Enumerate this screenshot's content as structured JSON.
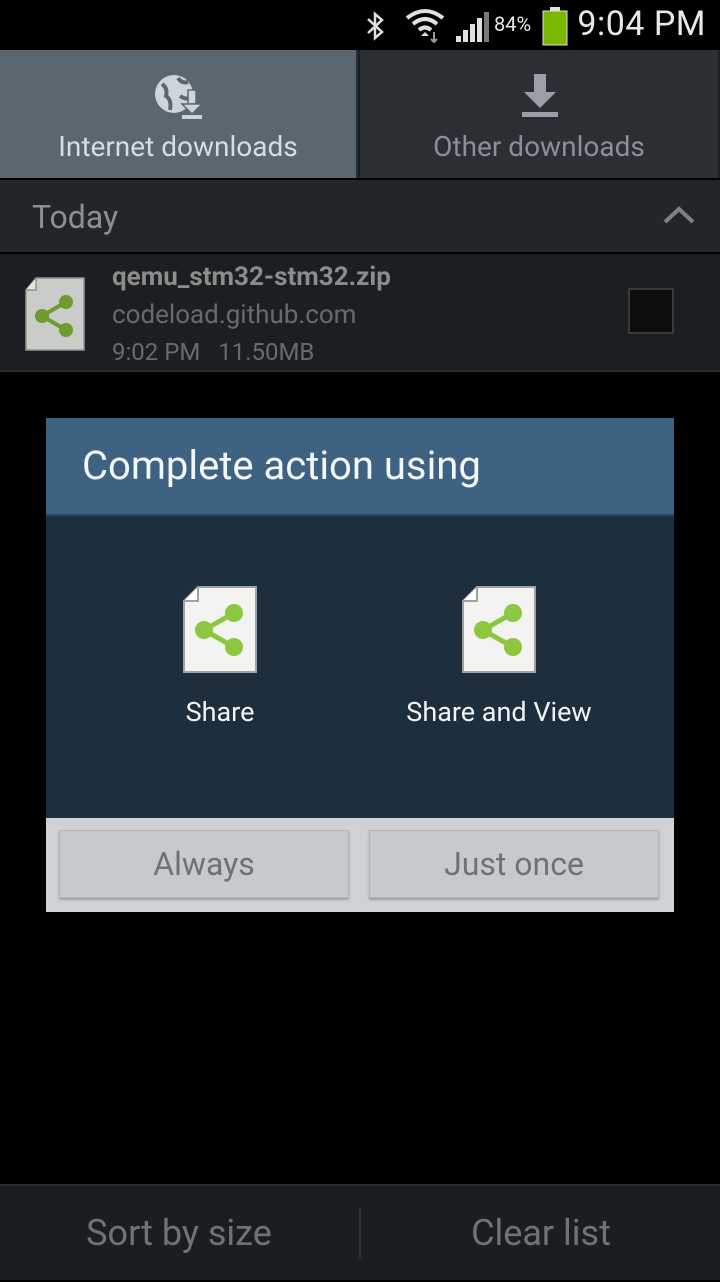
{
  "status_bar": {
    "battery_percent": "84%",
    "time": "9:04 PM",
    "icons": [
      "bluetooth-icon",
      "wifi-icon",
      "signal-icon",
      "battery-icon"
    ],
    "battery_color": "#7ab800"
  },
  "tabs": [
    {
      "label": "Internet downloads",
      "icon": "globe-download-icon",
      "active": true
    },
    {
      "label": "Other downloads",
      "icon": "download-arrow-icon",
      "active": false
    }
  ],
  "section": {
    "title": "Today",
    "toggle_icon": "chevron-up-icon"
  },
  "download_item": {
    "file_name": "qemu_stm32-stm32.zip",
    "source": "codeload.github.com",
    "time": "9:02 PM",
    "size": "11.50MB",
    "checked": false
  },
  "dialog": {
    "title": "Complete action using",
    "options": [
      {
        "label": "Share",
        "icon": "share-file-icon"
      },
      {
        "label": "Share and View",
        "icon": "share-file-icon"
      }
    ],
    "buttons": {
      "always": "Always",
      "just_once": "Just once"
    },
    "accent_color": "#3e6282",
    "share_color": "#8dc63f"
  },
  "bottom_bar": {
    "sort": "Sort by size",
    "clear": "Clear list"
  }
}
